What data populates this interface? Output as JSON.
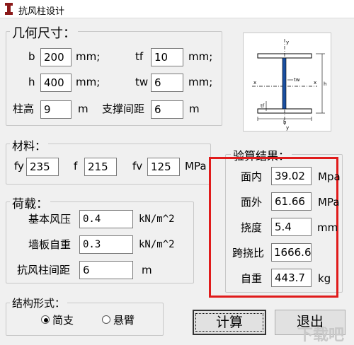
{
  "window": {
    "title": "抗风柱设计"
  },
  "geometry": {
    "legend": "几何尺寸：",
    "b": {
      "label": "b",
      "value": "200",
      "unit": "mm;"
    },
    "tf": {
      "label": "tf",
      "value": "10",
      "unit": "mm;"
    },
    "h": {
      "label": "h",
      "value": "400",
      "unit": "mm;"
    },
    "tw": {
      "label": "tw",
      "value": "6",
      "unit": "mm;"
    },
    "col_height": {
      "label": "柱高",
      "value": "9",
      "unit": "m"
    },
    "brace_spacing": {
      "label": "支撑间距",
      "value": "6",
      "unit": "m"
    }
  },
  "diagram": {
    "labels": {
      "y": "y",
      "x": "x",
      "tw": "tw",
      "tf": "tf",
      "h": "h",
      "b": "b"
    }
  },
  "material": {
    "legend": "材料：",
    "fy": {
      "label": "fy",
      "value": "235"
    },
    "f": {
      "label": "f",
      "value": "215"
    },
    "fv": {
      "label": "fv",
      "value": "125",
      "unit": "MPa"
    }
  },
  "loads": {
    "legend": "荷载：",
    "wind_pressure": {
      "label": "基本风压",
      "value": "0.4",
      "unit": "kN/m^2"
    },
    "wall_weight": {
      "label": "墙板自重",
      "value": "0.3",
      "unit": "kN/m^2"
    },
    "col_spacing": {
      "label": "抗风柱间距",
      "value": "6",
      "unit": "m"
    }
  },
  "results": {
    "legend": "验算结果：",
    "in_plane": {
      "label": "面内",
      "value": "39.02",
      "unit": "Mpa"
    },
    "out_plane": {
      "label": "面外",
      "value": "61.66",
      "unit": "MPa"
    },
    "deflection": {
      "label": "挠度",
      "value": "5.4",
      "unit": "mm"
    },
    "span_ratio": {
      "label": "跨挠比",
      "value": "1666.6"
    },
    "self_weight": {
      "label": "自重",
      "value": "443.7",
      "unit": "kg"
    }
  },
  "structure": {
    "legend": "结构形式：",
    "options": [
      {
        "label": "简支",
        "selected": true
      },
      {
        "label": "悬臂",
        "selected": false
      }
    ]
  },
  "buttons": {
    "calc": "计算",
    "exit": "退出"
  },
  "watermark": "下载吧"
}
